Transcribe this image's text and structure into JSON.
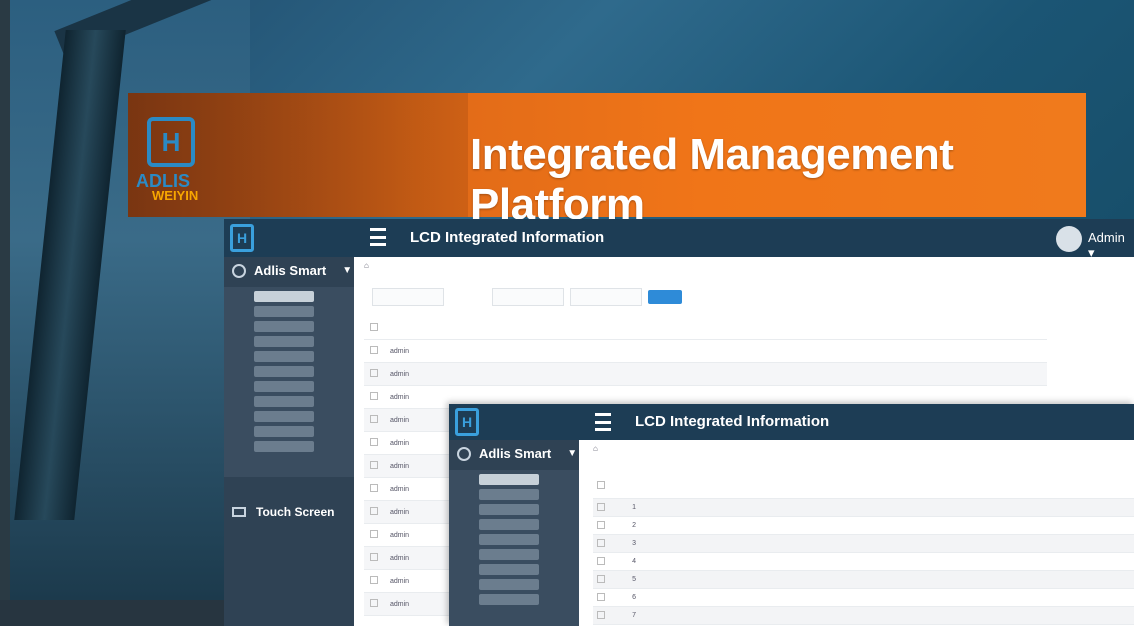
{
  "banner": {
    "logo_letters": "H",
    "logo_name": "ADLIS",
    "logo_sub": "WEIYIN",
    "title": "Integrated Management Platform"
  },
  "window1": {
    "app_title": "LCD Integrated Information",
    "user": "Admin",
    "sidebar_header": "Adlis Smart",
    "sidebar_touch": "Touch Screen",
    "breadcrumb": "",
    "filter": {
      "label_user": "",
      "label_op": "",
      "search_button": ""
    },
    "table": {
      "columns": [
        "",
        "",
        "",
        "",
        "",
        "",
        "",
        ""
      ],
      "rows": [
        [
          "",
          "admin",
          "",
          "",
          "",
          "",
          "",
          ""
        ],
        [
          "",
          "admin",
          "",
          "",
          "",
          "",
          "",
          ""
        ],
        [
          "",
          "admin",
          "",
          "",
          "",
          "",
          "",
          ""
        ],
        [
          "",
          "admin",
          "",
          "",
          "",
          "",
          "",
          ""
        ],
        [
          "",
          "admin",
          "",
          "",
          "",
          "",
          "",
          ""
        ],
        [
          "",
          "admin",
          "",
          "",
          "",
          "",
          "",
          ""
        ],
        [
          "",
          "admin",
          "",
          "",
          "",
          "",
          "",
          ""
        ],
        [
          "",
          "admin",
          "",
          "",
          "",
          "",
          "",
          ""
        ],
        [
          "",
          "admin",
          "",
          "",
          "",
          "",
          "",
          ""
        ],
        [
          "",
          "admin",
          "",
          "",
          "",
          "",
          "",
          ""
        ],
        [
          "",
          "admin",
          "",
          "",
          "",
          "",
          "",
          ""
        ],
        [
          "",
          "admin",
          "",
          "",
          "",
          "",
          "",
          ""
        ]
      ]
    }
  },
  "window2": {
    "app_title": "LCD Integrated Information",
    "sidebar_header": "Adlis Smart",
    "table": {
      "rows": [
        {
          "num": "1"
        },
        {
          "num": "2"
        },
        {
          "num": "3"
        },
        {
          "num": "4"
        },
        {
          "num": "5"
        },
        {
          "num": "6"
        },
        {
          "num": "7"
        }
      ]
    }
  }
}
